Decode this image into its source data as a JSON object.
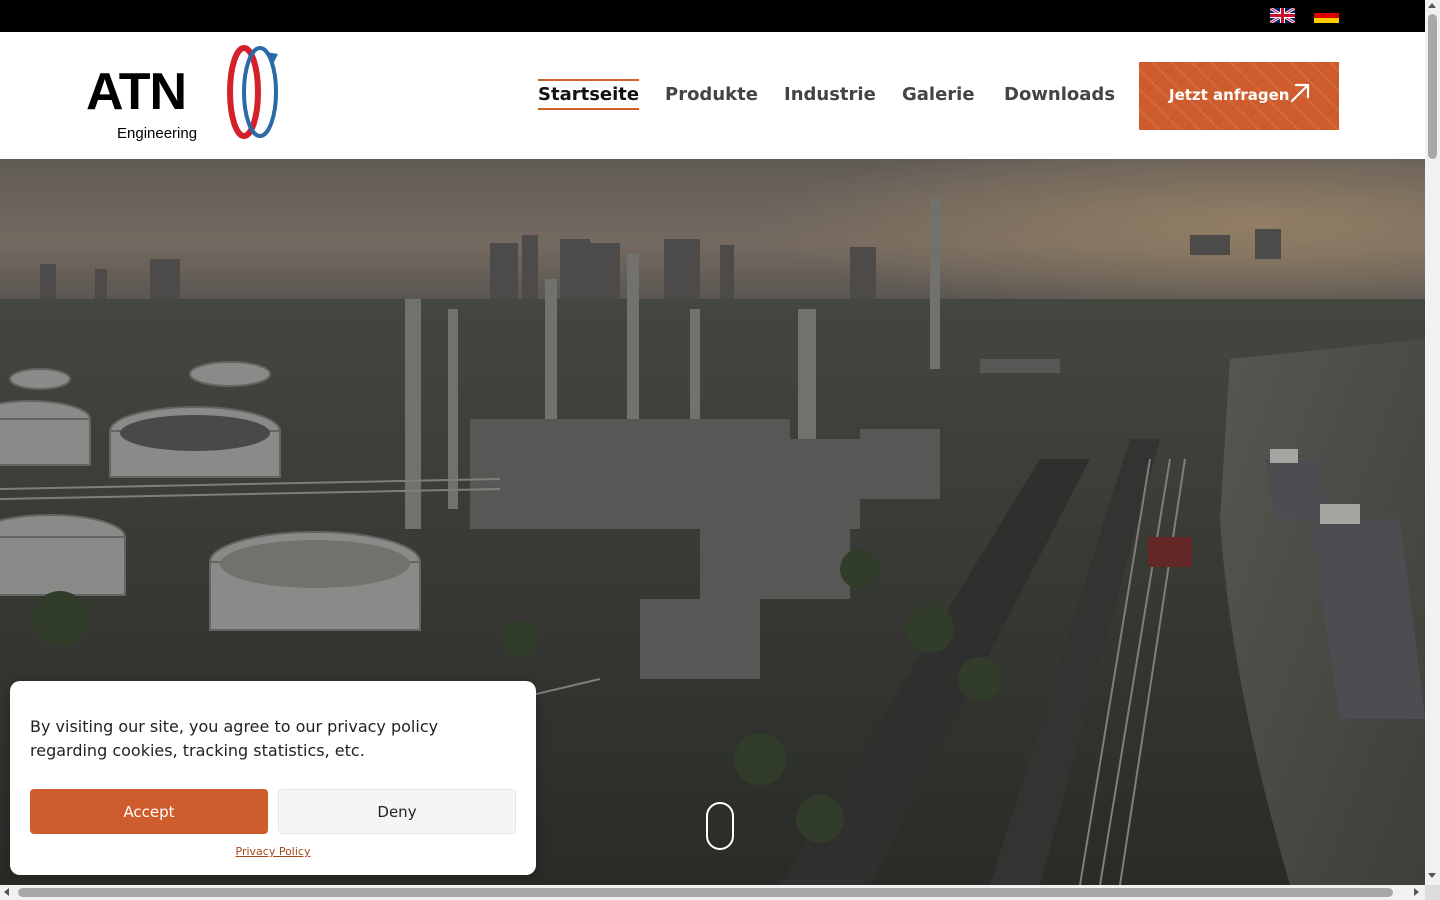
{
  "languages": [
    {
      "code": "en",
      "label": "English",
      "icon": "uk-flag-icon"
    },
    {
      "code": "de",
      "label": "Deutsch",
      "icon": "germany-flag-icon"
    }
  ],
  "logo": {
    "wordmark": "ATN",
    "subtitle": "Engineering",
    "colors": {
      "red": "#d3202b",
      "blue": "#2a6aa6"
    }
  },
  "nav": {
    "items": [
      {
        "label": "Startseite",
        "active": true
      },
      {
        "label": "Produkte",
        "active": false
      },
      {
        "label": "Industrie",
        "active": false
      },
      {
        "label": "Galerie",
        "active": false
      },
      {
        "label": "Downloads",
        "active": false
      }
    ],
    "accent": "#d0602e"
  },
  "cta": {
    "label": "Jetzt anfragen",
    "icon": "arrow-up-right-icon",
    "color": "#cf5c2c"
  },
  "hero": {
    "icon": "mouse-scroll-icon"
  },
  "cookie": {
    "message": "By visiting our site, you agree to our privacy policy regarding cookies, tracking statistics, etc.",
    "accept_label": "Accept",
    "deny_label": "Deny",
    "privacy_label": "Privacy Policy"
  }
}
